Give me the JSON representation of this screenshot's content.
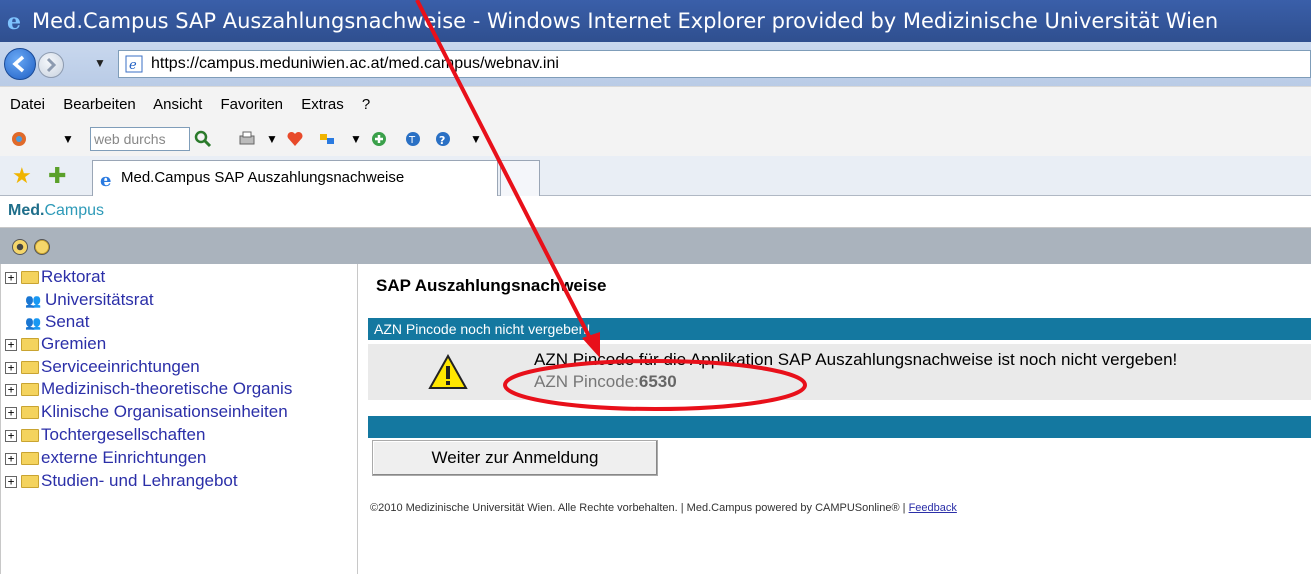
{
  "window": {
    "title": "Med.Campus SAP Auszahlungsnachweise - Windows Internet Explorer provided by Medizinische Universität Wien"
  },
  "address_bar": {
    "url": "https://campus.meduniwien.ac.at/med.campus/webnav.ini"
  },
  "menu": {
    "items": [
      "Datei",
      "Bearbeiten",
      "Ansicht",
      "Favoriten",
      "Extras",
      "?"
    ]
  },
  "toolbar": {
    "search_placeholder": "web durchs"
  },
  "tabs": [
    {
      "label": "Med.Campus SAP Auszahlungsnachweise"
    }
  ],
  "app_header": {
    "brand_part1": "Med.",
    "brand_part2": "Campus"
  },
  "sidebar": {
    "items": [
      {
        "label": "Rektorat",
        "type": "folder"
      },
      {
        "label": "Universitätsrat",
        "type": "people"
      },
      {
        "label": "Senat",
        "type": "people"
      },
      {
        "label": "Gremien",
        "type": "folder"
      },
      {
        "label": "Serviceeinrichtungen",
        "type": "folder"
      },
      {
        "label": "Medizinisch-theoretische Organis",
        "type": "folder"
      },
      {
        "label": "Klinische Organisationseinheiten",
        "type": "folder"
      },
      {
        "label": "Tochtergesellschaften",
        "type": "folder"
      },
      {
        "label": "externe Einrichtungen",
        "type": "folder"
      },
      {
        "label": "Studien- und Lehrangebot",
        "type": "folder"
      }
    ]
  },
  "content": {
    "title": "SAP Auszahlungsnachweise",
    "status_bar": "AZN Pincode noch nicht vergeben!",
    "message": "AZN Pincode für die Applikation SAP Auszahlungsnachweise ist noch nicht vergeben!",
    "pincode_label": "AZN Pincode:",
    "pincode_value": "6530",
    "continue_button": "Weiter zur Anmeldung",
    "footer_text": "©2010 Medizinische Universität Wien. Alle Rechte vorbehalten. | Med.Campus powered by CAMPUSonline® |",
    "footer_link": "Feedback"
  },
  "colors": {
    "annotation_red": "#e8101a",
    "status_blue": "#1478a0",
    "link_blue": "#2b2fa8"
  }
}
